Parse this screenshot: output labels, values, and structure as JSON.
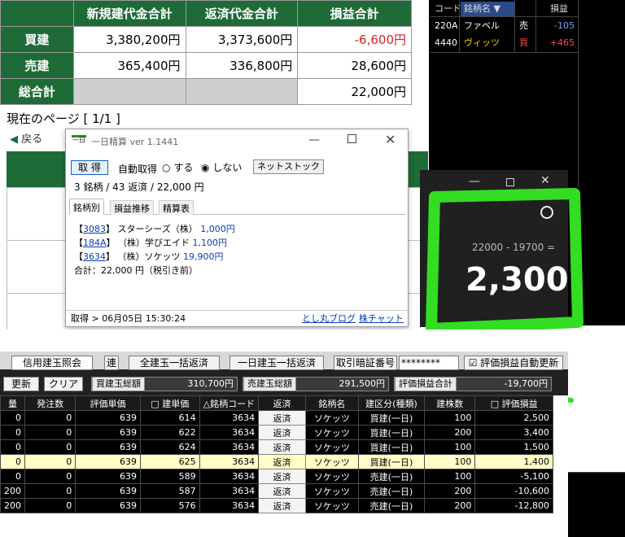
{
  "summary": {
    "headers": [
      "新規建代金合計",
      "返済代金合計",
      "損益合計"
    ],
    "rows": [
      {
        "label": "買建",
        "new": "3,380,200円",
        "repay": "3,373,600円",
        "pl": "-6,600円"
      },
      {
        "label": "売建",
        "new": "365,400円",
        "repay": "336,800円",
        "pl": "28,600円"
      },
      {
        "label": "総合計",
        "new": "",
        "repay": "",
        "pl": "22,000円"
      }
    ],
    "page_label": "現在のページ [ 1/1 ]",
    "back_label": "戻る"
  },
  "right_panel": {
    "headers": [
      "コード",
      "銘柄名",
      "",
      "損益"
    ],
    "rows": [
      {
        "code": "220A",
        "name": "ファベル",
        "side": "売",
        "pl": "-105"
      },
      {
        "code": "4440",
        "name": "ヴィッツ",
        "side": "買",
        "pl": "+465"
      }
    ]
  },
  "mini_app": {
    "title": "一日精算 ver 1.1441",
    "icon_text": "一日",
    "fetch_button": "取 得",
    "auto_label": "自動取得",
    "radio_on": "する",
    "radio_off": "しない",
    "netstock_button": "ネットストック",
    "status": "3 銘柄 / 43 返済 / 22,000 円",
    "tabs": [
      "銘柄別",
      "損益推移",
      "精算表"
    ],
    "items": [
      {
        "code": "3083",
        "name": "スターシーズ（株）",
        "amount": "1,000円"
      },
      {
        "code": "184A",
        "name": "（株）学びエイド",
        "amount": "1,100円"
      },
      {
        "code": "3634",
        "name": "（株）ソケッツ",
        "amount": "19,900円"
      }
    ],
    "total": "合計：22,000 円（税引き前）",
    "footer_fetch": "取得 > 06月05日 15:30:24",
    "footer_blog": "とし丸ブログ",
    "footer_chart": "株チャット"
  },
  "calculator": {
    "expression": "22000 - 19700 =",
    "result": "2,300"
  },
  "broker": {
    "tab_label": "信用建玉照会",
    "tab_short": "連",
    "bulk_repay": "全建玉一括返済",
    "day_bulk_repay": "一日建玉一括返済",
    "pin_label": "取引暗証番号",
    "pin_value": "********",
    "auto_update_label": "評価損益自動更新",
    "refresh_button": "更新",
    "clear_button": "クリア",
    "buy_total_label": "買建玉総額",
    "buy_total_value": "310,700円",
    "sell_total_label": "売建玉総額",
    "sell_total_value": "291,500円",
    "pl_total_label": "評価損益合計",
    "pl_total_value": "-19,700円",
    "columns": [
      "発注数",
      "評価単価",
      "□ 建単価",
      "△銘柄コード",
      "返済",
      "銘柄名",
      "建区分(種類)",
      "建株数",
      "□ 評価損益"
    ],
    "rows": [
      {
        "pre": "0",
        "orders": "0",
        "eval": "639",
        "entry": "614",
        "code": "3634",
        "repay": "返済",
        "name": "ソケッツ",
        "kind": "買建(一日)",
        "qty": "100",
        "pl": "2,500"
      },
      {
        "pre": "0",
        "orders": "0",
        "eval": "639",
        "entry": "622",
        "code": "3634",
        "repay": "返済",
        "name": "ソケッツ",
        "kind": "買建(一日)",
        "qty": "200",
        "pl": "3,400"
      },
      {
        "pre": "0",
        "orders": "0",
        "eval": "639",
        "entry": "624",
        "code": "3634",
        "repay": "返済",
        "name": "ソケッツ",
        "kind": "買建(一日)",
        "qty": "100",
        "pl": "1,500"
      },
      {
        "pre": "0",
        "orders": "0",
        "eval": "639",
        "entry": "625",
        "code": "3634",
        "repay": "返済",
        "name": "ソケッツ",
        "kind": "買建(一日)",
        "qty": "100",
        "pl": "1,400"
      },
      {
        "pre": "0",
        "orders": "0",
        "eval": "639",
        "entry": "589",
        "code": "3634",
        "repay": "返済",
        "name": "ソケッツ",
        "kind": "売建(一日)",
        "qty": "100",
        "pl": "-5,100"
      },
      {
        "pre": "200",
        "orders": "0",
        "eval": "639",
        "entry": "587",
        "code": "3634",
        "repay": "返済",
        "name": "ソケッツ",
        "kind": "売建(一日)",
        "qty": "200",
        "pl": "-10,600"
      },
      {
        "pre": "200",
        "orders": "0",
        "eval": "639",
        "entry": "576",
        "code": "3634",
        "repay": "返済",
        "name": "ソケッツ",
        "kind": "売建(一日)",
        "qty": "200",
        "pl": "-12,800"
      }
    ]
  },
  "colors": {
    "green": "#1e6b38",
    "highlight": "#33dd22",
    "negative": "#e02020",
    "dark": "#000000"
  }
}
